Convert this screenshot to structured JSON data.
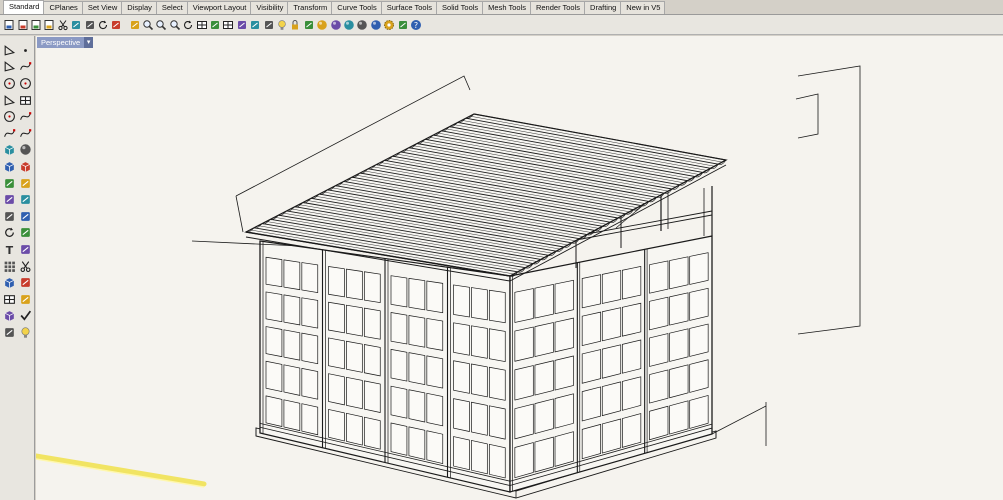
{
  "tabs": [
    {
      "label": "Standard",
      "active": true
    },
    {
      "label": "CPlanes"
    },
    {
      "label": "Set View"
    },
    {
      "label": "Display"
    },
    {
      "label": "Select"
    },
    {
      "label": "Viewport Layout"
    },
    {
      "label": "Visibility"
    },
    {
      "label": "Transform"
    },
    {
      "label": "Curve Tools"
    },
    {
      "label": "Surface Tools"
    },
    {
      "label": "Solid Tools"
    },
    {
      "label": "Mesh Tools"
    },
    {
      "label": "Render Tools"
    },
    {
      "label": "Drafting"
    },
    {
      "label": "New in V5"
    }
  ],
  "toolbar_icons": [
    "new-icon",
    "save-icon",
    "print-icon",
    "import-icon",
    "cut-icon",
    "copy-icon",
    "paste-icon",
    "undo-icon",
    "pan-icon",
    "sep",
    "move-view-icon",
    "zoom-window-icon",
    "zoom-extents-icon",
    "zoom-selected-icon",
    "rotate-view-icon",
    "four-views-icon",
    "set-cplane-icon",
    "grid-icon",
    "osnap-icon",
    "select-icon",
    "layer-icon",
    "light-bulb-icon",
    "lock-icon",
    "properties-icon",
    "color-wheel-icon",
    "render-sphere-icon",
    "shaded-sphere-icon",
    "ghosted-sphere-icon",
    "material-sphere-icon",
    "gear-icon",
    "dimension-icon",
    "help-icon"
  ],
  "left_icons": [
    [
      "select-arrow-icon",
      "point-icon"
    ],
    [
      "polyline-icon",
      "curve-icon"
    ],
    [
      "circle-icon",
      "arc-icon"
    ],
    [
      "triangle-icon",
      "rectangle-icon"
    ],
    [
      "ellipse-icon",
      "fillet-curve-icon"
    ],
    [
      "surface-icon",
      "sweep-icon"
    ],
    [
      "box-solid-icon",
      "sphere-solid-icon"
    ],
    [
      "cylinder-icon",
      "mesh-box-icon"
    ],
    [
      "boolean-icon",
      "explode-icon"
    ],
    [
      "trim-icon",
      "split-icon"
    ],
    [
      "join-icon",
      "group-icon"
    ],
    [
      "rotate-icon",
      "scale-icon"
    ],
    [
      "text-icon",
      "transform-icon"
    ],
    [
      "array-icon",
      "mirror-icon"
    ],
    [
      "block-icon",
      "ruler-icon"
    ],
    [
      "array-grid-icon",
      "orient-icon"
    ],
    [
      "cylinder-blue-icon",
      "check-icon"
    ],
    [
      "render-material-icon",
      "lamp-icon"
    ]
  ],
  "viewport": {
    "title": "Perspective",
    "menu_arrow": "▾"
  },
  "colors": {
    "viewport_bg": "#f5f3ee",
    "line": "#1a1a1a",
    "highlight": "#f0e04a",
    "tab_active_bg": "#8b9ac4"
  }
}
